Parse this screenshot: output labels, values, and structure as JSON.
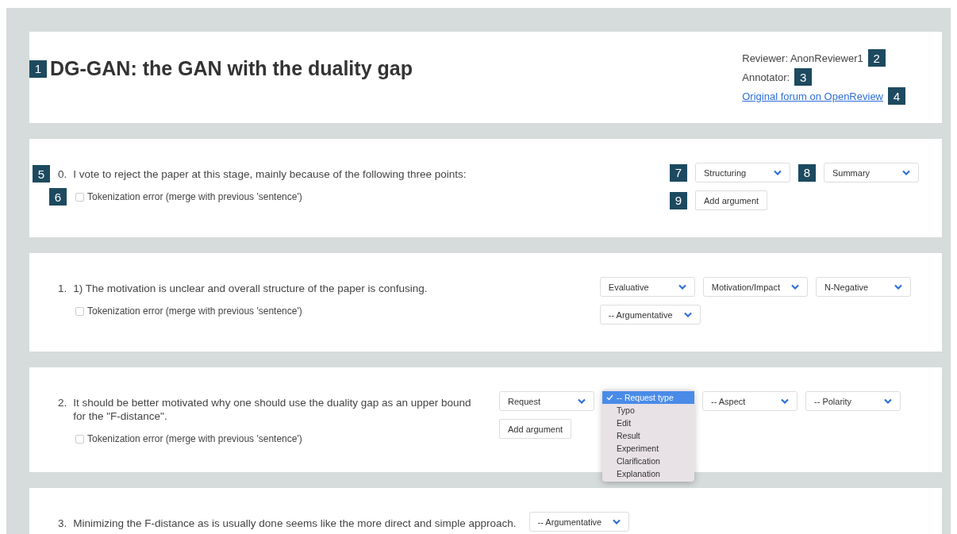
{
  "header": {
    "title": "DG-GAN: the GAN with the duality gap",
    "title_marker": "1",
    "meta": [
      {
        "kind": "text",
        "text": "Reviewer: AnonReviewer1",
        "marker": "2"
      },
      {
        "kind": "text",
        "text": "Annotator:",
        "marker": "3"
      },
      {
        "kind": "link",
        "text": "Original forum on OpenReview",
        "marker": "4"
      }
    ]
  },
  "sentences": [
    {
      "number": "0.",
      "text": "I vote to reject the paper at this stage, mainly because of the following three points:",
      "marker": "5",
      "inline": false,
      "checkbox": {
        "label": "Tokenization error (merge with previous 'sentence')",
        "checked": false,
        "marker": "6"
      },
      "rows": [
        [
          {
            "kind": "select",
            "value": "Structuring",
            "marker": "7"
          },
          {
            "kind": "select",
            "value": "Summary",
            "marker": "8"
          }
        ],
        [
          {
            "kind": "button",
            "value": "Add argument",
            "marker": "9"
          }
        ]
      ]
    },
    {
      "number": "1.",
      "text": "1) The motivation is unclear and overall structure of the paper is confusing.",
      "inline": false,
      "checkbox": {
        "label": "Tokenization error (merge with previous 'sentence')",
        "checked": false
      },
      "rows": [
        [
          {
            "kind": "select",
            "value": "Evaluative"
          },
          {
            "kind": "select",
            "value": "Motivation/Impact"
          },
          {
            "kind": "select",
            "value": "N-Negative"
          }
        ],
        [
          {
            "kind": "select",
            "value": "-- Argumentative"
          }
        ]
      ]
    },
    {
      "number": "2.",
      "text": "It should be better motivated why one should use the duality gap as an upper bound for the \"F-distance\".",
      "inline": false,
      "checkbox": {
        "label": "Tokenization error (merge with previous 'sentence')",
        "checked": false
      },
      "rows": [
        [
          {
            "kind": "select",
            "value": "Request"
          },
          {
            "kind": "menu",
            "options": [
              {
                "label": "-- Request type",
                "selected": true
              },
              {
                "label": "Typo",
                "selected": false
              },
              {
                "label": "Edit",
                "selected": false
              },
              {
                "label": "Result",
                "selected": false
              },
              {
                "label": "Experiment",
                "selected": false
              },
              {
                "label": "Clarification",
                "selected": false
              },
              {
                "label": "Explanation",
                "selected": false
              }
            ]
          },
          {
            "kind": "select",
            "value": "-- Aspect"
          },
          {
            "kind": "select",
            "value": "-- Polarity"
          }
        ],
        [
          {
            "kind": "button",
            "value": "Add argument"
          }
        ]
      ]
    },
    {
      "number": "3.",
      "text": "Minimizing the F-distance as is usually done seems like the more direct and simple approach.",
      "inline": true,
      "rows": [
        [
          {
            "kind": "select",
            "value": "-- Argumentative"
          }
        ]
      ]
    }
  ]
}
